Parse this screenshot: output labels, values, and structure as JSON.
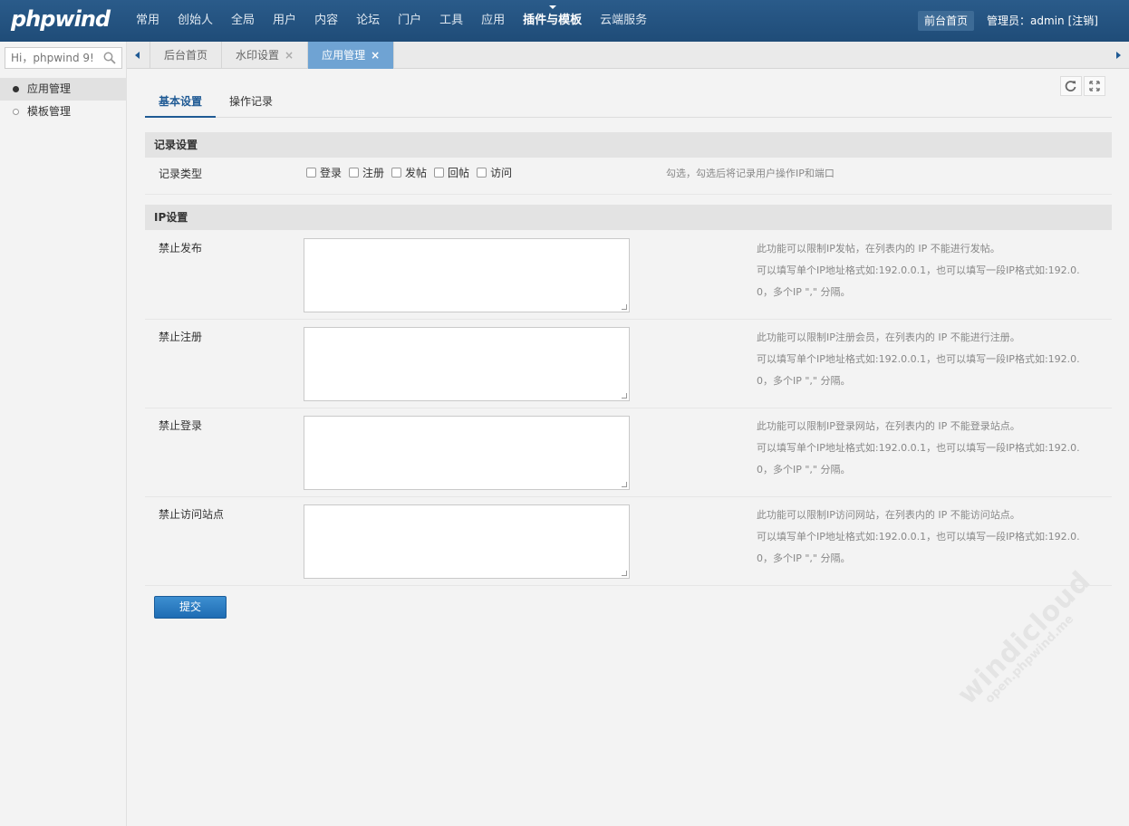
{
  "brand": {
    "logo": "phpwind"
  },
  "topnav": {
    "items": [
      "常用",
      "创始人",
      "全局",
      "用户",
      "内容",
      "论坛",
      "门户",
      "工具",
      "应用",
      "插件与模板",
      "云端服务"
    ],
    "active_index": 9,
    "front_label": "前台首页",
    "admin_label": "管理员：admin",
    "logout_label": "[注销]"
  },
  "sidebar": {
    "search_placeholder": "Hi，phpwind 9!",
    "items": [
      {
        "label": "应用管理",
        "active": true
      },
      {
        "label": "模板管理",
        "active": false
      }
    ]
  },
  "tabs": {
    "items": [
      {
        "label": "后台首页",
        "closable": false,
        "active": false
      },
      {
        "label": "水印设置",
        "closable": true,
        "active": false
      },
      {
        "label": "应用管理",
        "closable": true,
        "active": true
      }
    ],
    "close_glyph": "×"
  },
  "subtabs": [
    "基本设置",
    "操作记录"
  ],
  "record_section": {
    "title": "记录设置",
    "row_label": "记录类型",
    "checkboxes": [
      "登录",
      "注册",
      "发帖",
      "回帖",
      "访问"
    ],
    "tip": "勾选，勾选后将记录用户操作IP和端口"
  },
  "ip_section": {
    "title": "IP设置",
    "rows": [
      {
        "label": "禁止发布",
        "tip1": "此功能可以限制IP发帖，在列表内的 IP 不能进行发帖。",
        "tip2": "可以填写单个IP地址格式如:192.0.0.1，也可以填写一段IP格式如:192.0.",
        "tip3": "0，多个IP \",\" 分隔。"
      },
      {
        "label": "禁止注册",
        "tip1": "此功能可以限制IP注册会员，在列表内的 IP 不能进行注册。",
        "tip2": "可以填写单个IP地址格式如:192.0.0.1，也可以填写一段IP格式如:192.0.",
        "tip3": "0，多个IP \",\" 分隔。"
      },
      {
        "label": "禁止登录",
        "tip1": "此功能可以限制IP登录网站，在列表内的 IP 不能登录站点。",
        "tip2": "可以填写单个IP地址格式如:192.0.0.1，也可以填写一段IP格式如:192.0.",
        "tip3": "0，多个IP \",\" 分隔。"
      },
      {
        "label": "禁止访问站点",
        "tip1": "此功能可以限制IP访问网站，在列表内的 IP 不能访问站点。",
        "tip2": "可以填写单个IP地址格式如:192.0.0.1，也可以填写一段IP格式如:192.0.",
        "tip3": "0，多个IP \",\" 分隔。"
      }
    ]
  },
  "submit_label": "提交",
  "watermark": {
    "line1": "windicloud",
    "line2": "open.phpwind.me"
  },
  "colors": {
    "topbar": "#23527c",
    "accent": "#1f5a94",
    "active_tab": "#6fa3d3"
  }
}
